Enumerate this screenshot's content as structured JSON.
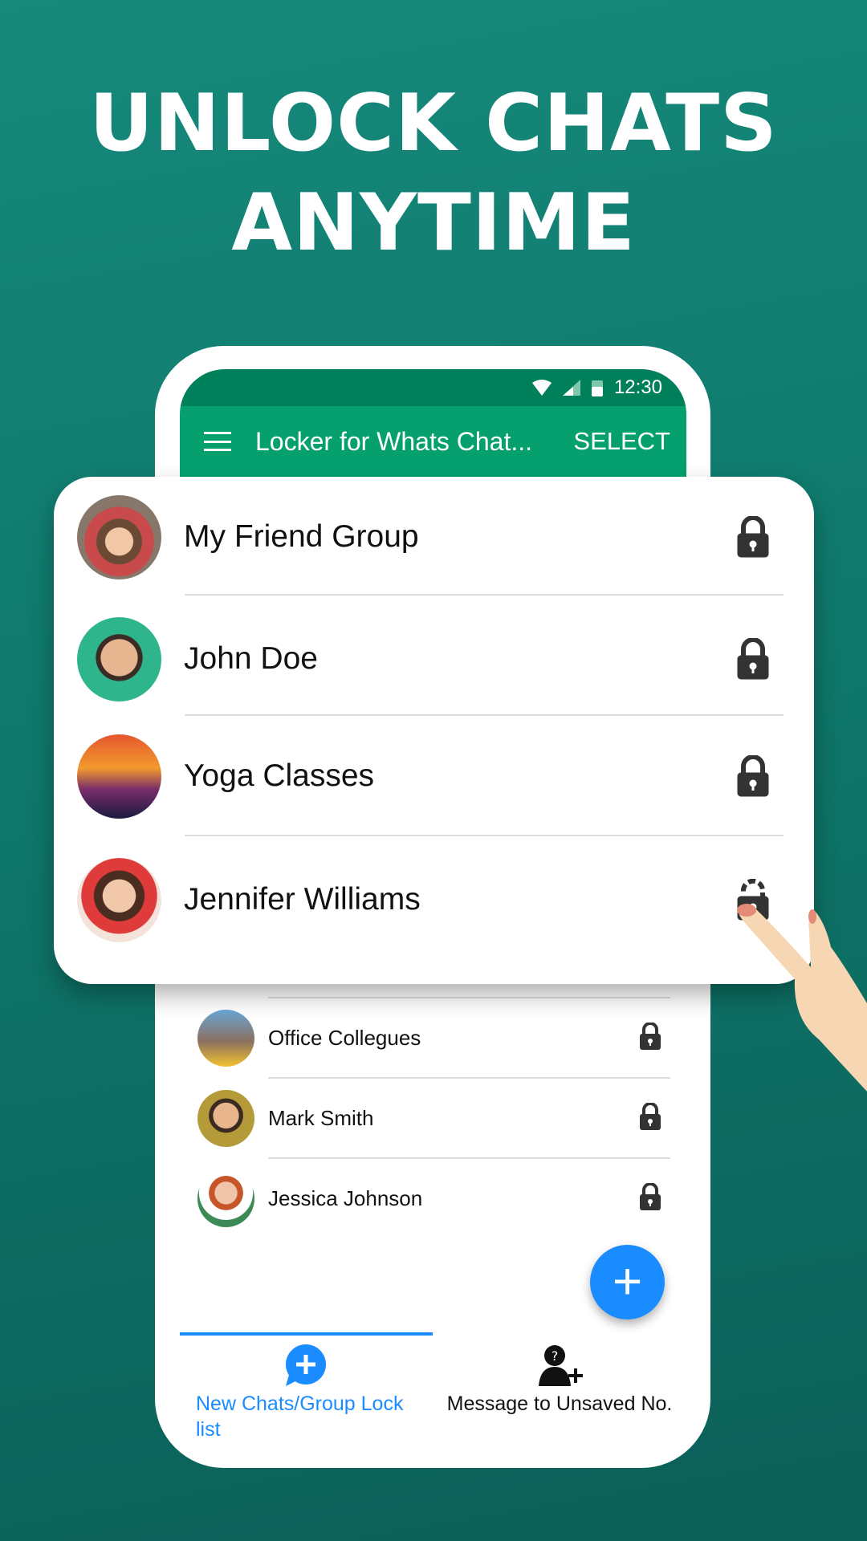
{
  "headline": {
    "line1": "UNLOCK CHATS",
    "line2": "ANYTIME"
  },
  "status_bar": {
    "time": "12:30"
  },
  "toolbar": {
    "title": "Locker for Whats Chat...",
    "select_label": "SELECT"
  },
  "featured_chats": [
    {
      "name": "My Friend Group",
      "locked": true
    },
    {
      "name": "John Doe",
      "locked": true
    },
    {
      "name": "Yoga Classes",
      "locked": true
    },
    {
      "name": "Jennifer Williams",
      "locked": false
    }
  ],
  "chats": [
    {
      "name": "Office Collegues",
      "locked": true
    },
    {
      "name": "Mark Smith",
      "locked": true
    },
    {
      "name": "Jessica Johnson",
      "locked": true
    }
  ],
  "fab": {
    "icon": "plus-icon",
    "label": "+"
  },
  "tabs": [
    {
      "label": "New Chats/Group Lock list",
      "active": true,
      "icon": "chat-plus-icon"
    },
    {
      "label": "Message to Unsaved No.",
      "active": false,
      "icon": "unknown-contact-add-icon"
    }
  ],
  "colors": {
    "background": "#0f7a6d",
    "status_bar": "#00805a",
    "toolbar": "#05a06e",
    "accent": "#1a8cff"
  }
}
